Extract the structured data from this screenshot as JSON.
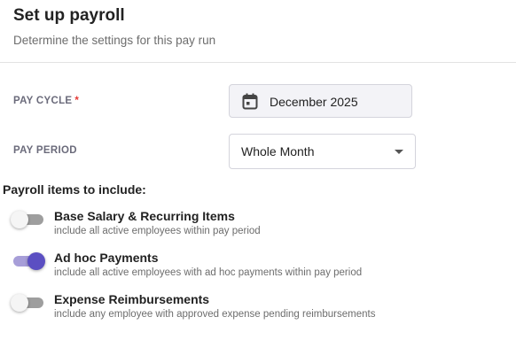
{
  "header": {
    "title": "Set up payroll",
    "subtitle": "Determine the settings for this pay run"
  },
  "pay_cycle": {
    "label": "PAY CYCLE",
    "required_mark": "*",
    "value": "December 2025",
    "icon": "calendar-icon"
  },
  "pay_period": {
    "label": "PAY PERIOD",
    "value": "Whole Month",
    "icon": "caret-down-icon"
  },
  "payroll_items": {
    "title": "Payroll items to include:",
    "items": [
      {
        "label": "Base Salary & Recurring Items",
        "description": "include all active employees within pay period",
        "enabled": false
      },
      {
        "label": "Ad hoc Payments",
        "description": "include all active employees with ad hoc payments within pay period",
        "enabled": true
      },
      {
        "label": "Expense Reimbursements",
        "description": "include any employee with approved expense pending reimbursements",
        "enabled": false
      }
    ]
  },
  "colors": {
    "accent": "#5b4fc2",
    "accent_track": "#a79ed8",
    "required": "#e53935",
    "muted_text": "#6d6d6d"
  }
}
